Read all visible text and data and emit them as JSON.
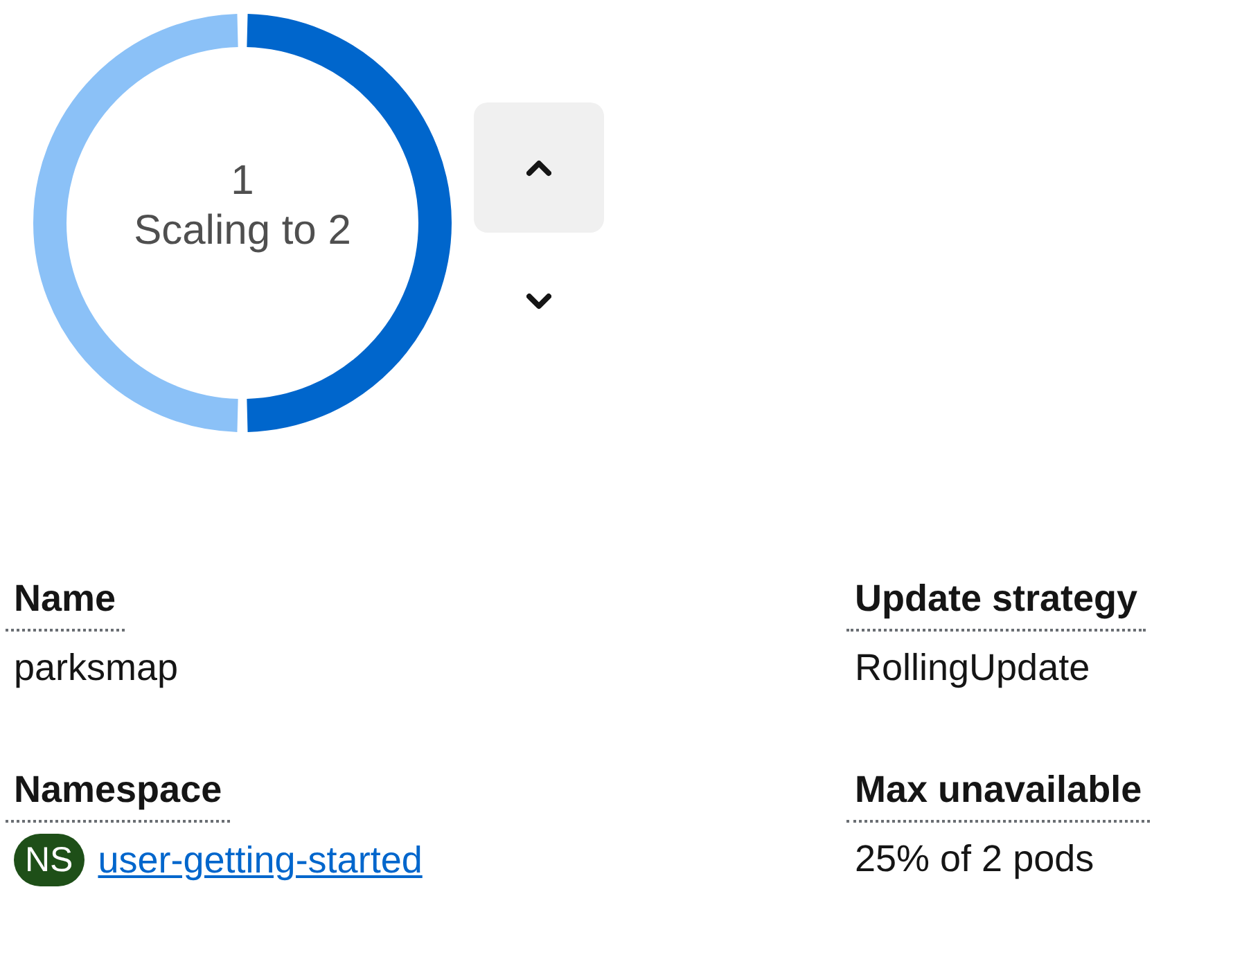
{
  "pod_ring": {
    "count": "1",
    "status": "Scaling to 2",
    "segments": [
      {
        "color": "#8bc1f7"
      },
      {
        "color": "#0066cc"
      }
    ]
  },
  "scale_buttons": [
    {
      "kind": "increase"
    },
    {
      "kind": "decrease"
    }
  ],
  "details": [
    {
      "label": "Name",
      "value": "parksmap"
    },
    {
      "label": "Update strategy",
      "value": "RollingUpdate"
    },
    {
      "label": "Namespace",
      "badge": "NS",
      "link": "user-getting-started"
    },
    {
      "label": "Max unavailable",
      "value": "25% of 2 pods"
    }
  ]
}
